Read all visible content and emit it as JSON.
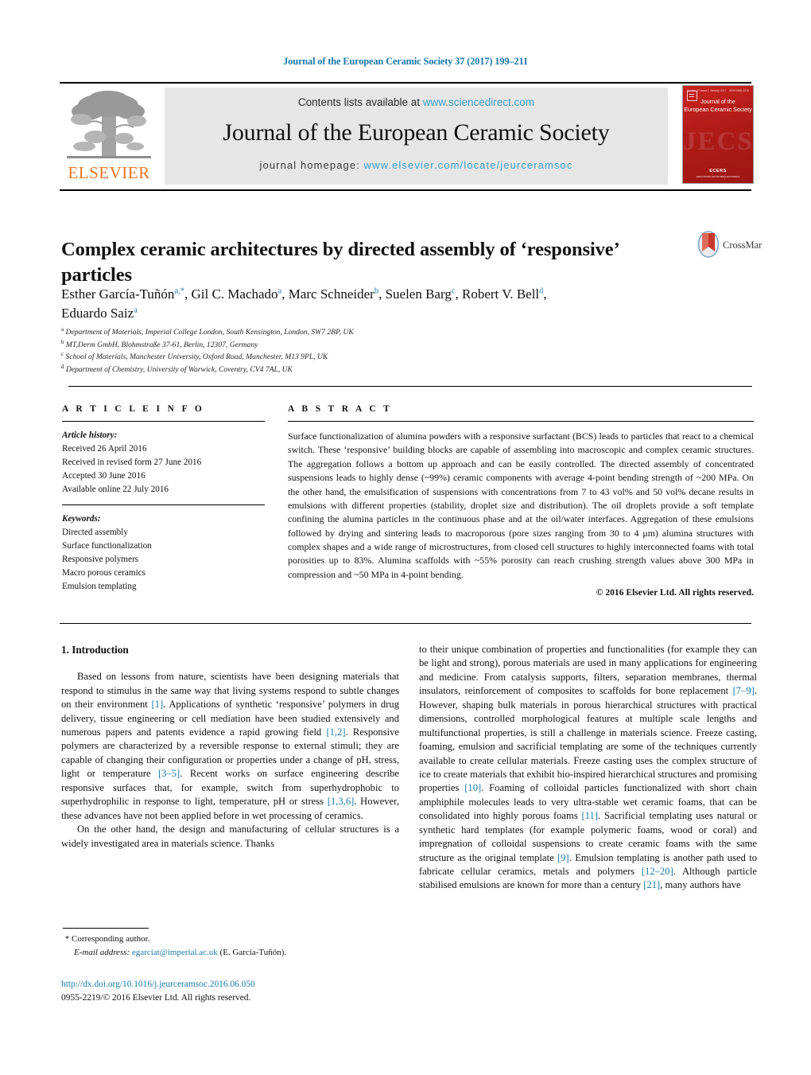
{
  "running_head": "Journal of the European Ceramic Society 37 (2017) 199–211",
  "masthead": {
    "publisher_name": "ELSEVIER",
    "contents_prefix": "Contents lists available at ",
    "contents_link": "www.sciencedirect.com",
    "journal_title": "Journal of the European Ceramic Society",
    "homepage_prefix": "journal homepage: ",
    "homepage_link": "www.elsevier.com/locate/jeurceramsoc",
    "cover": {
      "top_left": "Volume 37 Issue 1 January 2017",
      "top_right": "ISSN 0955-2219",
      "journal_name": "Journal of the\nEuropean Ceramic Society",
      "watermark": "JECS",
      "society": "ECERS",
      "url": "www.elsevier.com/locate/jeurceramsoc"
    }
  },
  "article": {
    "title": "Complex ceramic architectures by directed assembly of ‘responsive’ particles",
    "crossmark_label": "CrossMark",
    "authors_html": "Esther García-Tuñón<sup>a,*</sup>, Gil C. Machado<sup>a</sup>, Marc Schneider<sup>b</sup>, Suelen Barg<sup>c</sup>, Robert V. Bell<sup>d</sup>, Eduardo Saiz<sup>a</sup>",
    "affiliations": [
      {
        "mark": "a",
        "text": "Department of Materials, Imperial College London, South Kensington, London, SW7 2BP, UK"
      },
      {
        "mark": "b",
        "text": "MT,Derm GmbH, Blohmstraße 37-61, Berlin, 12307, Germany"
      },
      {
        "mark": "c",
        "text": "School of Materials, Manchester University, Oxford Road, Manchester, M13 9PL, UK"
      },
      {
        "mark": "d",
        "text": "Department of Chemistry, University of Warwick, Coventry, CV4 7AL, UK"
      }
    ]
  },
  "article_info": {
    "heading": "A R T I C L E   I N F O",
    "history_label": "Article history:",
    "history": [
      "Received 26 April 2016",
      "Received in revised form 27 June 2016",
      "Accepted 30 June 2016",
      "Available online 22 July 2016"
    ],
    "keywords_label": "Keywords:",
    "keywords": [
      "Directed assembly",
      "Surface functionalization",
      "Responsive polymers",
      "Macro porous ceramics",
      "Emulsion templating"
    ]
  },
  "abstract": {
    "heading": "A B S T R A C T",
    "text": "Surface functionalization of alumina powders with a responsive surfactant (BCS) leads to particles that react to a chemical switch. These ‘responsive’ building blocks are capable of assembling into macroscopic and complex ceramic structures. The aggregation follows a bottom up approach and can be easily controlled. The directed assembly of concentrated suspensions leads to highly dense (~99%) ceramic components with average 4-point bending strength of ~200 MPa. On the other hand, the emulsification of suspensions with concentrations from 7 to 43 vol% and 50 vol% decane results in emulsions with different properties (stability, droplet size and distribution). The oil droplets provide a soft template confining the alumina particles in the continuous phase and at the oil/water interfaces. Aggregation of these emulsions followed by drying and sintering leads to macroporous (pore sizes ranging from 30 to 4 μm) alumina structures with complex shapes and a wide range of microstructures, from closed cell structures to highly interconnected foams with total porosities up to 83%. Alumina scaffolds with ~55% porosity can reach crushing strength values above 300 MPa in compression and ~50 MPa in 4-point bending.",
    "copyright": "© 2016 Elsevier Ltd. All rights reserved."
  },
  "body": {
    "section_heading": "1. Introduction",
    "left_paragraphs": [
      "Based on lessons from nature, scientists have been designing materials that respond to stimulus in the same way that living systems respond to subtle changes on their environment [1]. Applications of synthetic ‘responsive’ polymers in drug delivery, tissue engineering or cell mediation have been studied extensively and numerous papers and patents evidence a rapid growing field [1,2]. Responsive polymers are characterized by a reversible response to external stimuli; they are capable of changing their configuration or properties under a change of pH, stress, light or temperature [3–5]. Recent works on surface engineering describe responsive surfaces that, for example, switch from superhydrophobic to superhydrophilic in response to light, temperature, pH or stress [1,3,6]. However, these advances have not been applied before in wet processing of ceramics.",
      "On the other hand, the design and manufacturing of cellular structures is a widely investigated area in materials science. Thanks"
    ],
    "right_paragraphs": [
      "to their unique combination of properties and functionalities (for example they can be light and strong), porous materials are used in many applications for engineering and medicine. From catalysis supports, filters, separation membranes, thermal insulators, reinforcement of composites to scaffolds for bone replacement [7–9]. However, shaping bulk materials in porous hierarchical structures with practical dimensions, controlled morphological features at multiple scale lengths and multifunctional properties, is still a challenge in materials science. Freeze casting, foaming, emulsion and sacrificial templating are some of the techniques currently available to create cellular materials. Freeze casting uses the complex structure of ice to create materials that exhibit bio-inspired hierarchical structures and promising properties [10]. Foaming of colloidal particles functionalized with short chain amphiphile molecules leads to very ultra-stable wet ceramic foams, that can be consolidated into highly porous foams [11]. Sacrificial templating uses natural or synthetic hard templates (for example polymeric foams, wood or coral) and impregnation of colloidal suspensions to create ceramic foams with the same structure as the original template [9]. Emulsion templating is another path used to fabricate cellular ceramics, metals and polymers [12–20]. Although particle stabilised emulsions are known for more than a century [21], many authors have"
    ]
  },
  "footnote": {
    "corresponding_marker": "*",
    "corresponding_text": "Corresponding author.",
    "email_label": "E-mail address:",
    "email": "egarciat@imperial.ac.uk",
    "email_owner": "(E. García-Tuñón)."
  },
  "footer": {
    "doi": "http://dx.doi.org/10.1016/j.jeurceramsoc.2016.06.050",
    "issn_line": "0955-2219/© 2016 Elsevier Ltd. All rights reserved."
  },
  "colors": {
    "link_blue": "#1a7aa8",
    "sciencedirect_blue": "#3f9fc9",
    "elsevier_orange": "#e87722",
    "cover_red": "#b01b17",
    "band_grey": "#e6e6e6"
  }
}
